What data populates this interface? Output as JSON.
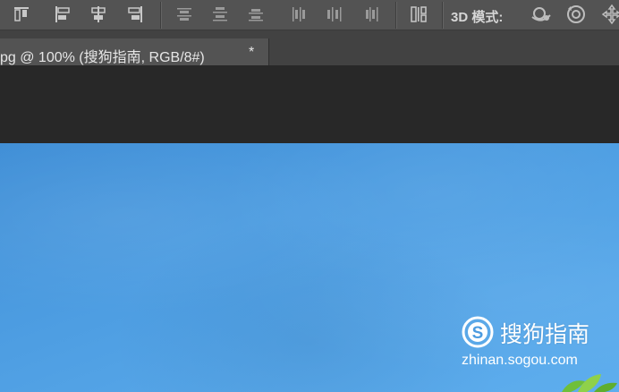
{
  "options_bar": {
    "mode_label": "3D 模式:",
    "align_icons": [
      "align-top-edges-icon",
      "align-left-edges-icon",
      "align-horizontal-centers-icon",
      "align-right-edges-icon"
    ],
    "distribute_icons": [
      "distribute-top-edges-icon",
      "distribute-vertical-centers-icon",
      "distribute-bottom-edges-icon",
      "distribute-left-edges-icon",
      "distribute-horizontal-centers-icon",
      "distribute-right-edges-icon",
      "auto-align-layers-icon"
    ],
    "mode_icons": [
      "3d-orbit-icon",
      "3d-roll-icon",
      "3d-pan-icon"
    ]
  },
  "document_tab": {
    "title": "pg @ 100% (搜狗指南, RGB/8#)",
    "close": "*"
  },
  "canvas": {
    "watermark_name": "搜狗指南",
    "watermark_url": "zhinan.sogou.com",
    "background_color": "#4b9be0"
  },
  "colors": {
    "options_bar_bg": "#535353",
    "pasteboard_bg": "#282828",
    "tab_active_bg": "#535353"
  }
}
